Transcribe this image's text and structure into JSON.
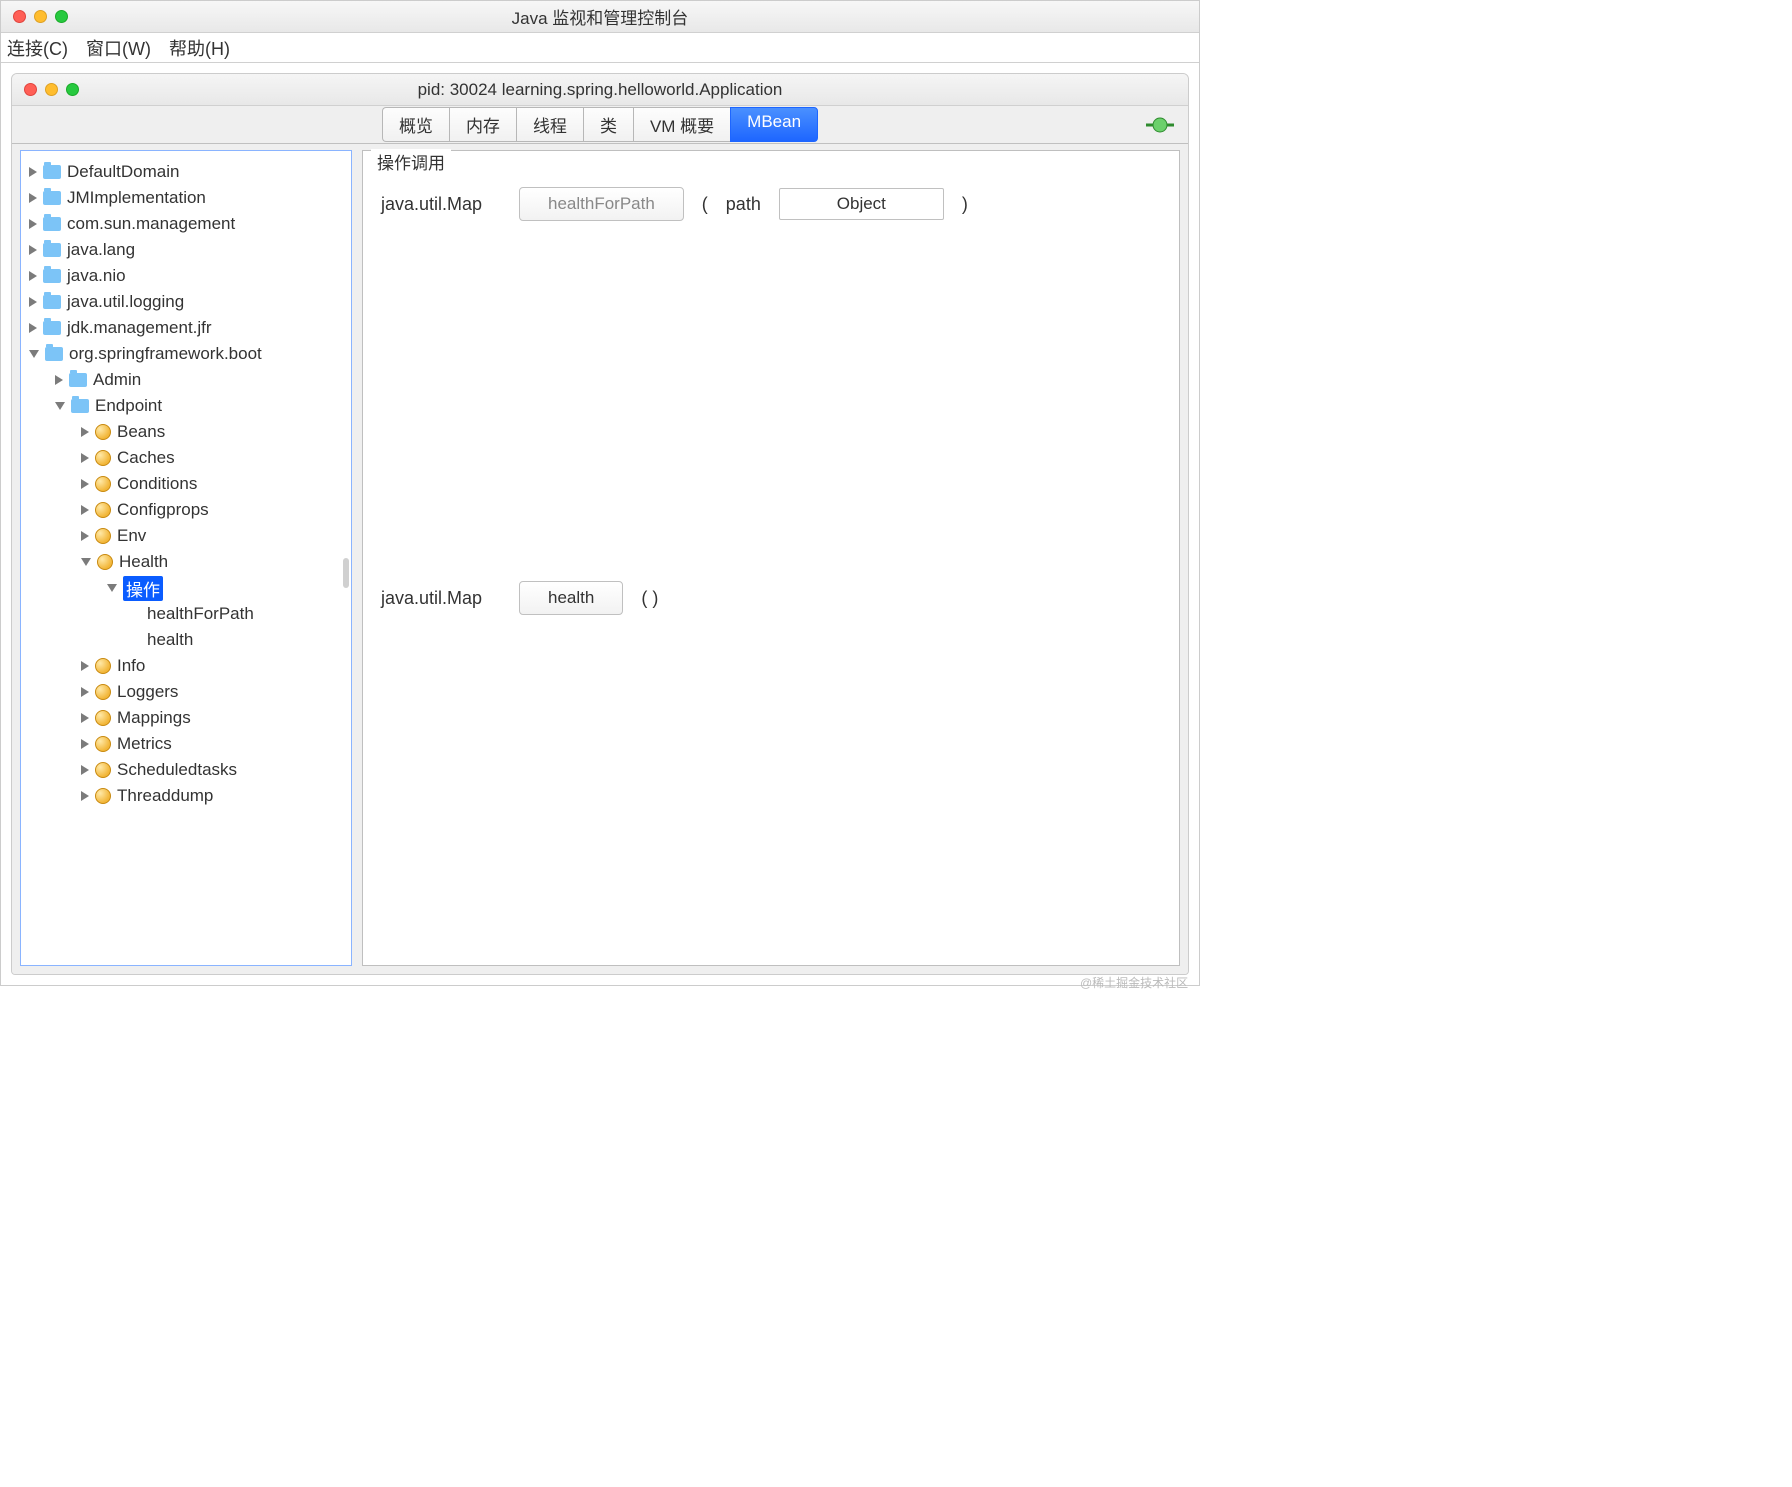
{
  "outerWindow": {
    "title": "Java 监视和管理控制台"
  },
  "menubar": {
    "items": [
      "连接(C)",
      "窗口(W)",
      "帮助(H)"
    ]
  },
  "innerWindow": {
    "title": "pid: 30024 learning.spring.helloworld.Application"
  },
  "tabs": {
    "items": [
      "概览",
      "内存",
      "线程",
      "类",
      "VM 概要",
      "MBean"
    ],
    "activeIndex": 5
  },
  "detail": {
    "fieldsetTitle": "操作调用",
    "op1": {
      "returnType": "java.util.Map",
      "button": "healthForPath",
      "openParen": "( ",
      "paramName": "path",
      "paramValue": "Object",
      "closeParen": " )"
    },
    "op2": {
      "returnType": "java.util.Map",
      "button": "health",
      "parens": "( )"
    }
  },
  "tree": {
    "nodes": [
      {
        "indent": 0,
        "disc": "right",
        "icon": "folder",
        "label": "DefaultDomain"
      },
      {
        "indent": 0,
        "disc": "right",
        "icon": "folder",
        "label": "JMImplementation"
      },
      {
        "indent": 0,
        "disc": "right",
        "icon": "folder",
        "label": "com.sun.management"
      },
      {
        "indent": 0,
        "disc": "right",
        "icon": "folder",
        "label": "java.lang"
      },
      {
        "indent": 0,
        "disc": "right",
        "icon": "folder",
        "label": "java.nio"
      },
      {
        "indent": 0,
        "disc": "right",
        "icon": "folder",
        "label": "java.util.logging"
      },
      {
        "indent": 0,
        "disc": "right",
        "icon": "folder",
        "label": "jdk.management.jfr"
      },
      {
        "indent": 0,
        "disc": "down",
        "icon": "folder",
        "label": "org.springframework.boot"
      },
      {
        "indent": 1,
        "disc": "right",
        "icon": "folder",
        "label": "Admin"
      },
      {
        "indent": 1,
        "disc": "down",
        "icon": "folder",
        "label": "Endpoint"
      },
      {
        "indent": 2,
        "disc": "right",
        "icon": "bean",
        "label": "Beans"
      },
      {
        "indent": 2,
        "disc": "right",
        "icon": "bean",
        "label": "Caches"
      },
      {
        "indent": 2,
        "disc": "right",
        "icon": "bean",
        "label": "Conditions"
      },
      {
        "indent": 2,
        "disc": "right",
        "icon": "bean",
        "label": "Configprops"
      },
      {
        "indent": 2,
        "disc": "right",
        "icon": "bean",
        "label": "Env"
      },
      {
        "indent": 2,
        "disc": "down",
        "icon": "bean",
        "label": "Health"
      },
      {
        "indent": 3,
        "disc": "down",
        "icon": "none",
        "label": "操作",
        "selected": true
      },
      {
        "indent": 4,
        "disc": "none",
        "icon": "none",
        "label": "healthForPath"
      },
      {
        "indent": 4,
        "disc": "none",
        "icon": "none",
        "label": "health"
      },
      {
        "indent": 2,
        "disc": "right",
        "icon": "bean",
        "label": "Info"
      },
      {
        "indent": 2,
        "disc": "right",
        "icon": "bean",
        "label": "Loggers"
      },
      {
        "indent": 2,
        "disc": "right",
        "icon": "bean",
        "label": "Mappings"
      },
      {
        "indent": 2,
        "disc": "right",
        "icon": "bean",
        "label": "Metrics"
      },
      {
        "indent": 2,
        "disc": "right",
        "icon": "bean",
        "label": "Scheduledtasks"
      },
      {
        "indent": 2,
        "disc": "right",
        "icon": "bean",
        "label": "Threaddump"
      }
    ]
  },
  "watermark": "@稀土掘金技术社区"
}
